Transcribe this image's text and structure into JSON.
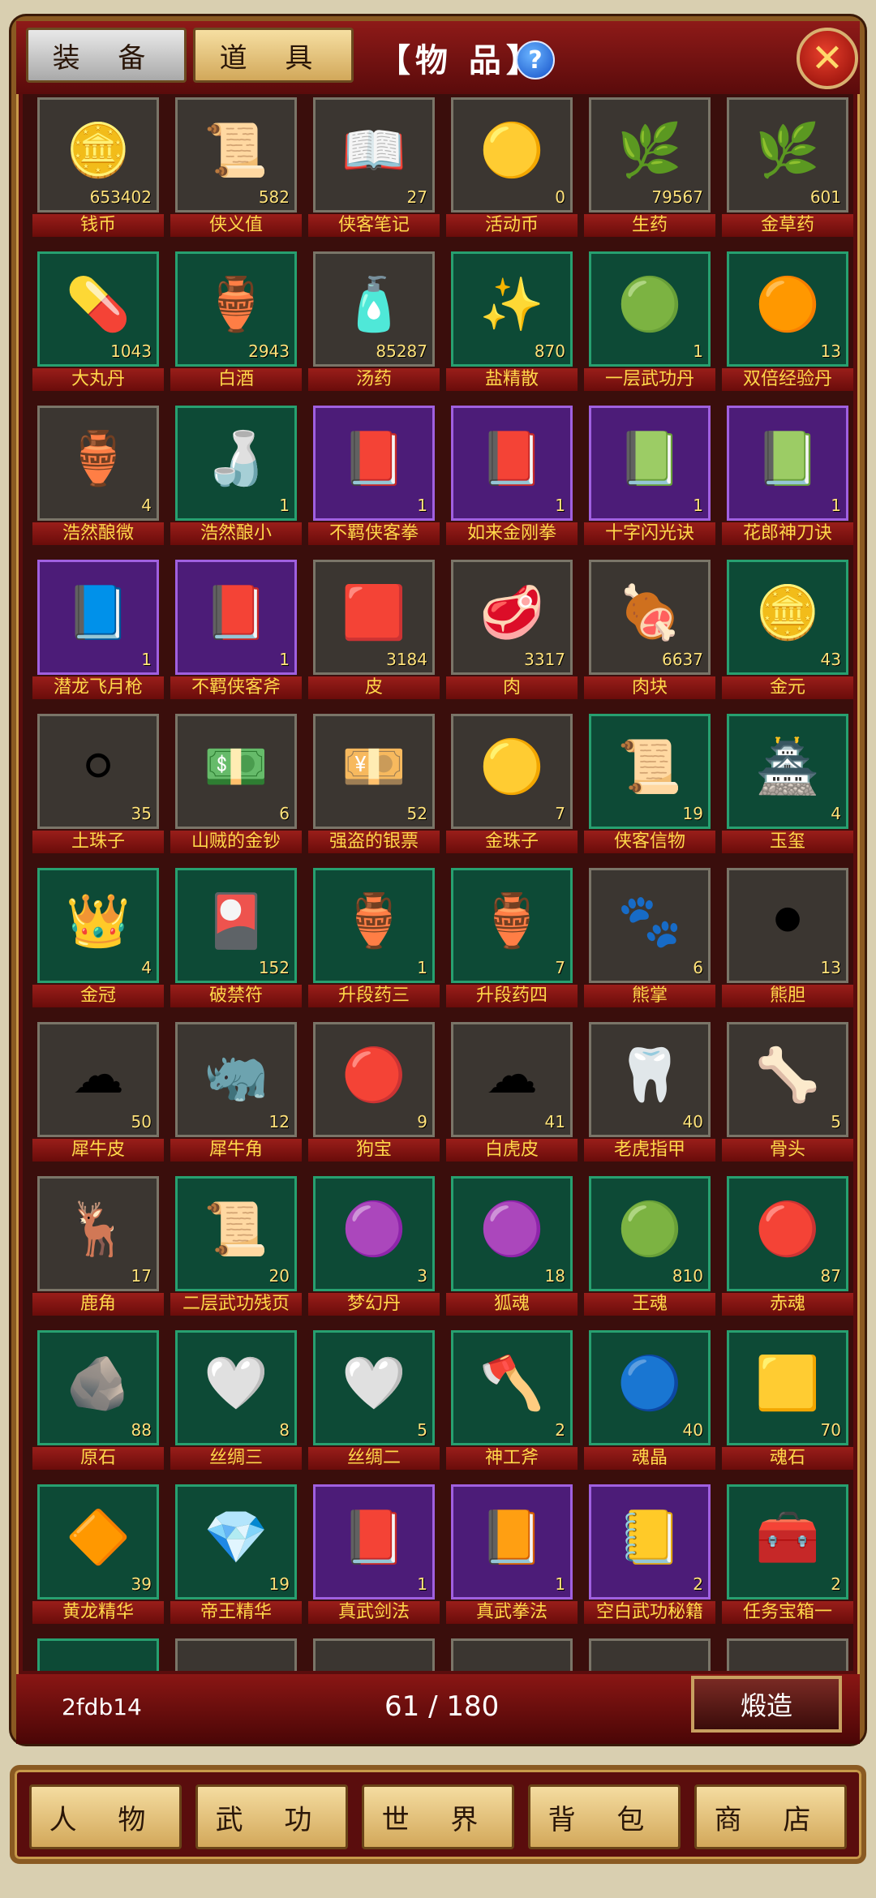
{
  "header": {
    "tabs": [
      "装 备",
      "道 具"
    ],
    "title": "【物 品】",
    "help_icon": "?",
    "close_icon": "✕"
  },
  "items": [
    {
      "name": "钱币",
      "count": "653402",
      "rarity": "gray",
      "icon": "coin-icon",
      "glyph": "🪙"
    },
    {
      "name": "侠义值",
      "count": "582",
      "rarity": "gray",
      "icon": "plaque-icon",
      "glyph": "📜"
    },
    {
      "name": "侠客笔记",
      "count": "27",
      "rarity": "gray",
      "icon": "book-icon",
      "glyph": "📖"
    },
    {
      "name": "活动币",
      "count": "0",
      "rarity": "gray",
      "icon": "gold-coin-icon",
      "glyph": "🟡"
    },
    {
      "name": "生药",
      "count": "79567",
      "rarity": "gray",
      "icon": "herb-icon",
      "glyph": "🌿"
    },
    {
      "name": "金草药",
      "count": "601",
      "rarity": "gray",
      "icon": "herb-icon",
      "glyph": "🌿"
    },
    {
      "name": "大丸丹",
      "count": "1043",
      "rarity": "green",
      "icon": "pills-icon",
      "glyph": "💊"
    },
    {
      "name": "白酒",
      "count": "2943",
      "rarity": "green",
      "icon": "wine-jar-icon",
      "glyph": "🏺"
    },
    {
      "name": "汤药",
      "count": "85287",
      "rarity": "gray",
      "icon": "bottle-icon",
      "glyph": "🧴"
    },
    {
      "name": "盐精散",
      "count": "870",
      "rarity": "green",
      "icon": "powder-icon",
      "glyph": "✨"
    },
    {
      "name": "一层武功丹",
      "count": "1",
      "rarity": "green",
      "icon": "orb-bowl-icon",
      "glyph": "🟢"
    },
    {
      "name": "双倍经验丹",
      "count": "13",
      "rarity": "green",
      "icon": "orb-bowl-icon",
      "glyph": "🟠"
    },
    {
      "name": "浩然酿微",
      "count": "4",
      "rarity": "gray",
      "icon": "wine-jar-icon",
      "glyph": "🏺"
    },
    {
      "name": "浩然酿小",
      "count": "1",
      "rarity": "green",
      "icon": "gourd-icon",
      "glyph": "🍶"
    },
    {
      "name": "不羁侠客拳",
      "count": "1",
      "rarity": "purple",
      "icon": "skill-book-icon",
      "glyph": "📕"
    },
    {
      "name": "如来金刚拳",
      "count": "1",
      "rarity": "purple",
      "icon": "skill-book-icon",
      "glyph": "📕"
    },
    {
      "name": "十字闪光诀",
      "count": "1",
      "rarity": "purple",
      "icon": "skill-book-icon",
      "glyph": "📗"
    },
    {
      "name": "花郎神刀诀",
      "count": "1",
      "rarity": "purple",
      "icon": "skill-book-icon",
      "glyph": "📗"
    },
    {
      "name": "潜龙飞月枪",
      "count": "1",
      "rarity": "purple",
      "icon": "skill-book-icon",
      "glyph": "📘"
    },
    {
      "name": "不羁侠客斧",
      "count": "1",
      "rarity": "purple",
      "icon": "skill-book-icon",
      "glyph": "📕"
    },
    {
      "name": "皮",
      "count": "3184",
      "rarity": "gray",
      "icon": "hide-icon",
      "glyph": "🟥"
    },
    {
      "name": "肉",
      "count": "3317",
      "rarity": "gray",
      "icon": "meat-icon",
      "glyph": "🥩"
    },
    {
      "name": "肉块",
      "count": "6637",
      "rarity": "gray",
      "icon": "ham-icon",
      "glyph": "🍖"
    },
    {
      "name": "金元",
      "count": "43",
      "rarity": "green",
      "icon": "gold-coin-icon",
      "glyph": "🪙"
    },
    {
      "name": "土珠子",
      "count": "35",
      "rarity": "gray",
      "icon": "pearl-icon",
      "glyph": "⚪"
    },
    {
      "name": "山贼的金钞",
      "count": "6",
      "rarity": "gray",
      "icon": "banknote-icon",
      "glyph": "💵"
    },
    {
      "name": "强盗的银票",
      "count": "52",
      "rarity": "gray",
      "icon": "banknote-icon",
      "glyph": "💴"
    },
    {
      "name": "金珠子",
      "count": "7",
      "rarity": "gray",
      "icon": "pearl-icon",
      "glyph": "🟡"
    },
    {
      "name": "侠客信物",
      "count": "19",
      "rarity": "green",
      "icon": "scroll-icon",
      "glyph": "📜"
    },
    {
      "name": "玉玺",
      "count": "4",
      "rarity": "green",
      "icon": "seal-icon",
      "glyph": "🏯"
    },
    {
      "name": "金冠",
      "count": "4",
      "rarity": "green",
      "icon": "crown-icon",
      "glyph": "👑"
    },
    {
      "name": "破禁符",
      "count": "152",
      "rarity": "green",
      "icon": "talisman-icon",
      "glyph": "🎴"
    },
    {
      "name": "升段药三",
      "count": "1",
      "rarity": "green",
      "icon": "jar-icon",
      "glyph": "🏺"
    },
    {
      "name": "升段药四",
      "count": "7",
      "rarity": "green",
      "icon": "jar-icon",
      "glyph": "🏺"
    },
    {
      "name": "熊掌",
      "count": "6",
      "rarity": "gray",
      "icon": "paw-icon",
      "glyph": "🐾"
    },
    {
      "name": "熊胆",
      "count": "13",
      "rarity": "gray",
      "icon": "gallbladder-icon",
      "glyph": "⚫"
    },
    {
      "name": "犀牛皮",
      "count": "50",
      "rarity": "gray",
      "icon": "fur-icon",
      "glyph": "☁"
    },
    {
      "name": "犀牛角",
      "count": "12",
      "rarity": "gray",
      "icon": "horn-icon",
      "glyph": "🦏"
    },
    {
      "name": "狗宝",
      "count": "9",
      "rarity": "gray",
      "icon": "bead-icon",
      "glyph": "🔴"
    },
    {
      "name": "白虎皮",
      "count": "41",
      "rarity": "gray",
      "icon": "fur-icon",
      "glyph": "☁"
    },
    {
      "name": "老虎指甲",
      "count": "40",
      "rarity": "gray",
      "icon": "claw-icon",
      "glyph": "🦷"
    },
    {
      "name": "骨头",
      "count": "5",
      "rarity": "gray",
      "icon": "bone-icon",
      "glyph": "🦴"
    },
    {
      "name": "鹿角",
      "count": "17",
      "rarity": "gray",
      "icon": "antler-icon",
      "glyph": "🦌"
    },
    {
      "name": "二层武功残页",
      "count": "20",
      "rarity": "green",
      "icon": "scroll-icon",
      "glyph": "📜"
    },
    {
      "name": "梦幻丹",
      "count": "3",
      "rarity": "green",
      "icon": "orb-icon",
      "glyph": "🟣"
    },
    {
      "name": "狐魂",
      "count": "18",
      "rarity": "green",
      "icon": "orb-icon",
      "glyph": "🟣"
    },
    {
      "name": "王魂",
      "count": "810",
      "rarity": "green",
      "icon": "orb-icon",
      "glyph": "🟢"
    },
    {
      "name": "赤魂",
      "count": "87",
      "rarity": "green",
      "icon": "orb-icon",
      "glyph": "🔴"
    },
    {
      "name": "原石",
      "count": "88",
      "rarity": "green",
      "icon": "ore-icon",
      "glyph": "🪨"
    },
    {
      "name": "丝绸三",
      "count": "8",
      "rarity": "green",
      "icon": "silk-icon",
      "glyph": "🤍"
    },
    {
      "name": "丝绸二",
      "count": "5",
      "rarity": "green",
      "icon": "silk-icon",
      "glyph": "🤍"
    },
    {
      "name": "神工斧",
      "count": "2",
      "rarity": "green",
      "icon": "axe-icon",
      "glyph": "🪓"
    },
    {
      "name": "魂晶",
      "count": "40",
      "rarity": "green",
      "icon": "crystal-icon",
      "glyph": "🔵"
    },
    {
      "name": "魂石",
      "count": "70",
      "rarity": "green",
      "icon": "gold-ingot-icon",
      "glyph": "🟨"
    },
    {
      "name": "黄龙精华",
      "count": "39",
      "rarity": "green",
      "icon": "gem-icon",
      "glyph": "🔶"
    },
    {
      "name": "帝王精华",
      "count": "19",
      "rarity": "green",
      "icon": "gem-icon",
      "glyph": "💎"
    },
    {
      "name": "真武剑法",
      "count": "1",
      "rarity": "purple",
      "icon": "manual-icon",
      "glyph": "📕"
    },
    {
      "name": "真武拳法",
      "count": "1",
      "rarity": "purple",
      "icon": "manual-icon",
      "glyph": "📙"
    },
    {
      "name": "空白武功秘籍",
      "count": "2",
      "rarity": "purple",
      "icon": "manual-icon",
      "glyph": "📒"
    },
    {
      "name": "任务宝箱一",
      "count": "2",
      "rarity": "green",
      "icon": "chest-icon",
      "glyph": "🧰"
    }
  ],
  "footer": {
    "code": "2fdb14",
    "pager": "61 / 180",
    "forge_label": "煅造"
  },
  "nav": [
    "人 物",
    "武 功",
    "世 界",
    "背 包",
    "商 店"
  ],
  "colors": {
    "frame": "#5a0d0d",
    "label_text": "#ffd84a",
    "count_text": "#ffe27a"
  }
}
